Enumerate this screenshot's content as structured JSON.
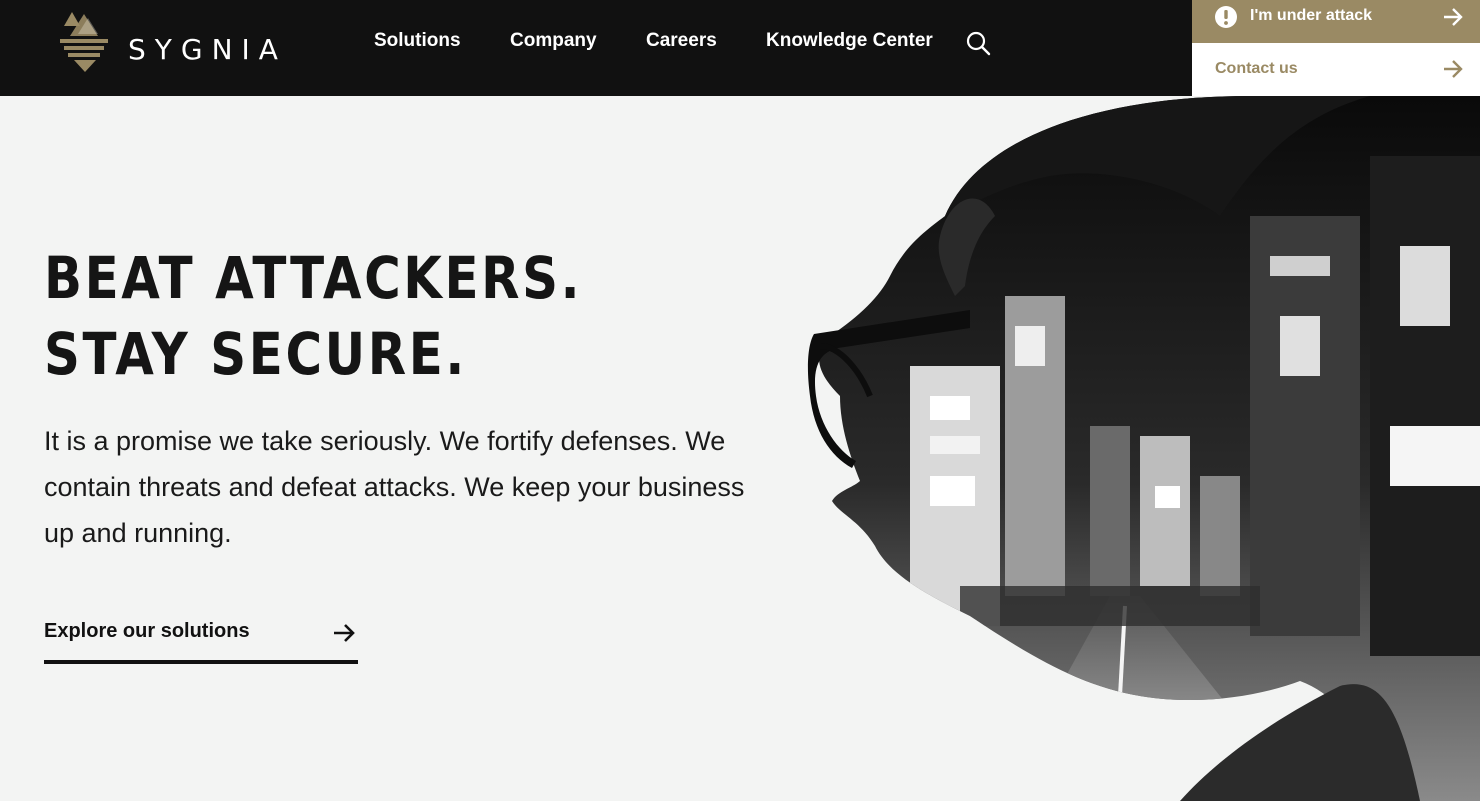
{
  "brand": {
    "name": "SYGNIA",
    "accent": "#9a8a64",
    "header_bg": "#111111"
  },
  "nav": {
    "items": [
      {
        "label": "Solutions"
      },
      {
        "label": "Company"
      },
      {
        "label": "Careers"
      },
      {
        "label": "Knowledge Center"
      }
    ],
    "search_icon": "search-icon"
  },
  "cta": {
    "attack": {
      "label": "I'm under attack",
      "icon": "alert-icon"
    },
    "contact": {
      "label": "Contact us",
      "icon": "arrow-right-icon"
    }
  },
  "hero": {
    "title_line1": "BEAT ATTACKERS.",
    "title_line2": "STAY SECURE.",
    "body": "It is a promise we take seriously. We fortify defenses. We contain threats and defeat attacks. We keep your business up and running.",
    "cta_label": "Explore our solutions",
    "image": "double-exposure portrait with city street"
  }
}
